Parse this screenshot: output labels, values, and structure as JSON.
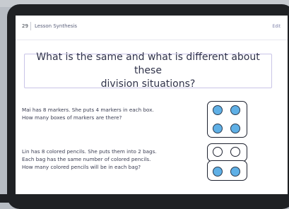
{
  "header": {
    "page_number": "29",
    "breadcrumb": "Lesson Synthesis",
    "edit_label": "Edit"
  },
  "prompt": {
    "line1": "What is the same and what is different about these",
    "line2": "division situations?"
  },
  "situation1": {
    "line1": "Mai has 8 markers. She puts 4 markers in each box.",
    "line2": "How many boxes of markers are there?"
  },
  "situation2": {
    "line1": "Lin has 8 colored pencils. She puts them into 2 bags.",
    "line2": "Each bag has the same number of colored pencils.",
    "line3": "How many colored pencils will be in each bag?"
  },
  "colors": {
    "blue_fill": "#5fb0e6",
    "prompt_border": "#c9c4e7",
    "text": "#3a3d52"
  },
  "icons": [
    "blue-circle-icon",
    "empty-circle-icon"
  ]
}
